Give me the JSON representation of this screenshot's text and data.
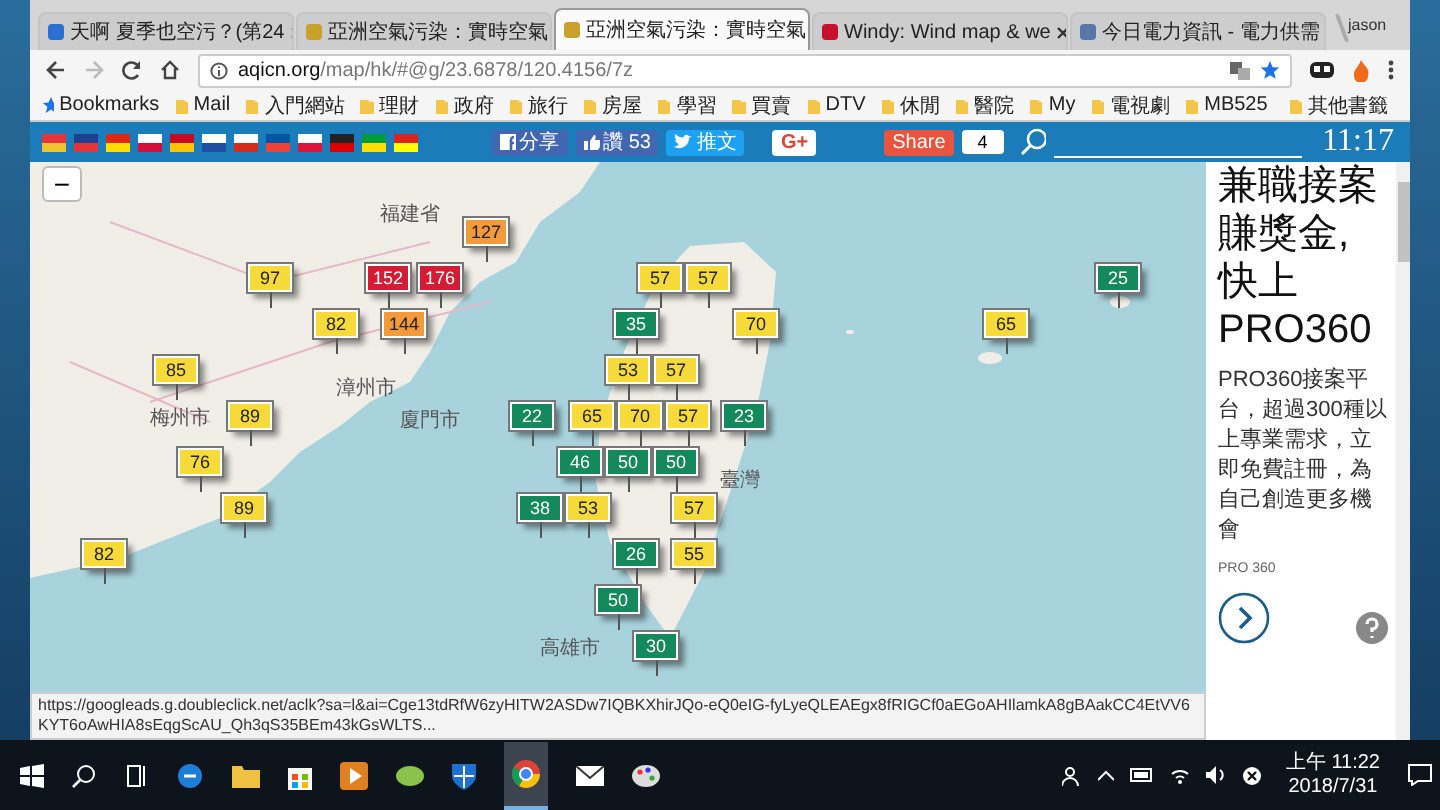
{
  "browser": {
    "tabs": [
      {
        "title": "天啊 夏季也空污？(第24",
        "selected": false,
        "kind": "page"
      },
      {
        "title": "亞洲空氣污染：實時空氣",
        "selected": false,
        "kind": "aqi"
      },
      {
        "title": "亞洲空氣污染：實時空氣",
        "selected": true,
        "kind": "aqi"
      },
      {
        "title": "Windy: Wind map & we",
        "selected": false,
        "kind": "windy"
      },
      {
        "title": "今日電力資訊 - 電力供需",
        "selected": false,
        "kind": "info"
      }
    ],
    "user": "jason",
    "address": {
      "host": "aqicn.org",
      "path": "/map/hk/#@g/23.6878/120.4156/7z"
    },
    "bookmarks": [
      "Bookmarks",
      "Mail",
      "入門網站",
      "理財",
      "政府",
      "旅行",
      "房屋",
      "學習",
      "買賣",
      "DTV",
      "休閒",
      "醫院",
      "My",
      "電視劇",
      "MB525"
    ],
    "other_bookmarks": "其他書籤",
    "status_url": "https://googleads.g.doubleclick.net/aclk?sa=l&ai=Cge13tdRfW6zyHITW2ASDw7IQBKXhirJQo-eQ0eIG-fyLyeQLEAEgx8fRIGCf0aEGoAHIlamkA8gBAakCC4EtVV6KYT6oAwHIA8sEqgScAU_Qh3qS35BEm43kGsWLTS..."
  },
  "header": {
    "fb_share": "分享",
    "like": "讚",
    "like_count": "53",
    "tweet": "推文",
    "gplus": "G+",
    "share": "Share",
    "share_count": "4",
    "time": "11:17"
  },
  "map": {
    "zoom_out": "−",
    "labels": [
      "福建省",
      "漳州市",
      "梅州市",
      "廈門市",
      "臺灣",
      "高雄市"
    ],
    "markers": [
      {
        "value": "127",
        "color": "#f39a3a"
      },
      {
        "value": "97",
        "color": "#f5da3a"
      },
      {
        "value": "152",
        "color": "#d41c35"
      },
      {
        "value": "176",
        "color": "#d41c35"
      },
      {
        "value": "57",
        "color": "#f5da3a"
      },
      {
        "value": "57",
        "color": "#f5da3a"
      },
      {
        "value": "25",
        "color": "#148a5c"
      },
      {
        "value": "82",
        "color": "#f5da3a"
      },
      {
        "value": "144",
        "color": "#f39a3a"
      },
      {
        "value": "35",
        "color": "#148a5c"
      },
      {
        "value": "70",
        "color": "#f5da3a"
      },
      {
        "value": "65",
        "color": "#f5da3a"
      },
      {
        "value": "85",
        "color": "#f5da3a"
      },
      {
        "value": "53",
        "color": "#f5da3a"
      },
      {
        "value": "57",
        "color": "#f5da3a"
      },
      {
        "value": "89",
        "color": "#f5da3a"
      },
      {
        "value": "22",
        "color": "#148a5c"
      },
      {
        "value": "65",
        "color": "#f5da3a"
      },
      {
        "value": "70",
        "color": "#f5da3a"
      },
      {
        "value": "57",
        "color": "#f5da3a"
      },
      {
        "value": "23",
        "color": "#148a5c"
      },
      {
        "value": "76",
        "color": "#f5da3a"
      },
      {
        "value": "46",
        "color": "#148a5c"
      },
      {
        "value": "50",
        "color": "#148a5c"
      },
      {
        "value": "50",
        "color": "#148a5c"
      },
      {
        "value": "89",
        "color": "#f5da3a"
      },
      {
        "value": "38",
        "color": "#148a5c"
      },
      {
        "value": "53",
        "color": "#f5da3a"
      },
      {
        "value": "57",
        "color": "#f5da3a"
      },
      {
        "value": "82",
        "color": "#f5da3a"
      },
      {
        "value": "26",
        "color": "#148a5c"
      },
      {
        "value": "55",
        "color": "#f5da3a"
      },
      {
        "value": "50",
        "color": "#148a5c"
      },
      {
        "value": "30",
        "color": "#148a5c"
      }
    ]
  },
  "ad": {
    "headline": [
      "兼職接案",
      "賺獎金,",
      "快上",
      "PRO360"
    ],
    "body": "PRO360接案平台，超過300種以上專業需求，立即免費註冊，為自己創造更多機會",
    "source": "PRO 360"
  },
  "taskbar": {
    "time": "上午 11:22",
    "date": "2018/7/31"
  }
}
